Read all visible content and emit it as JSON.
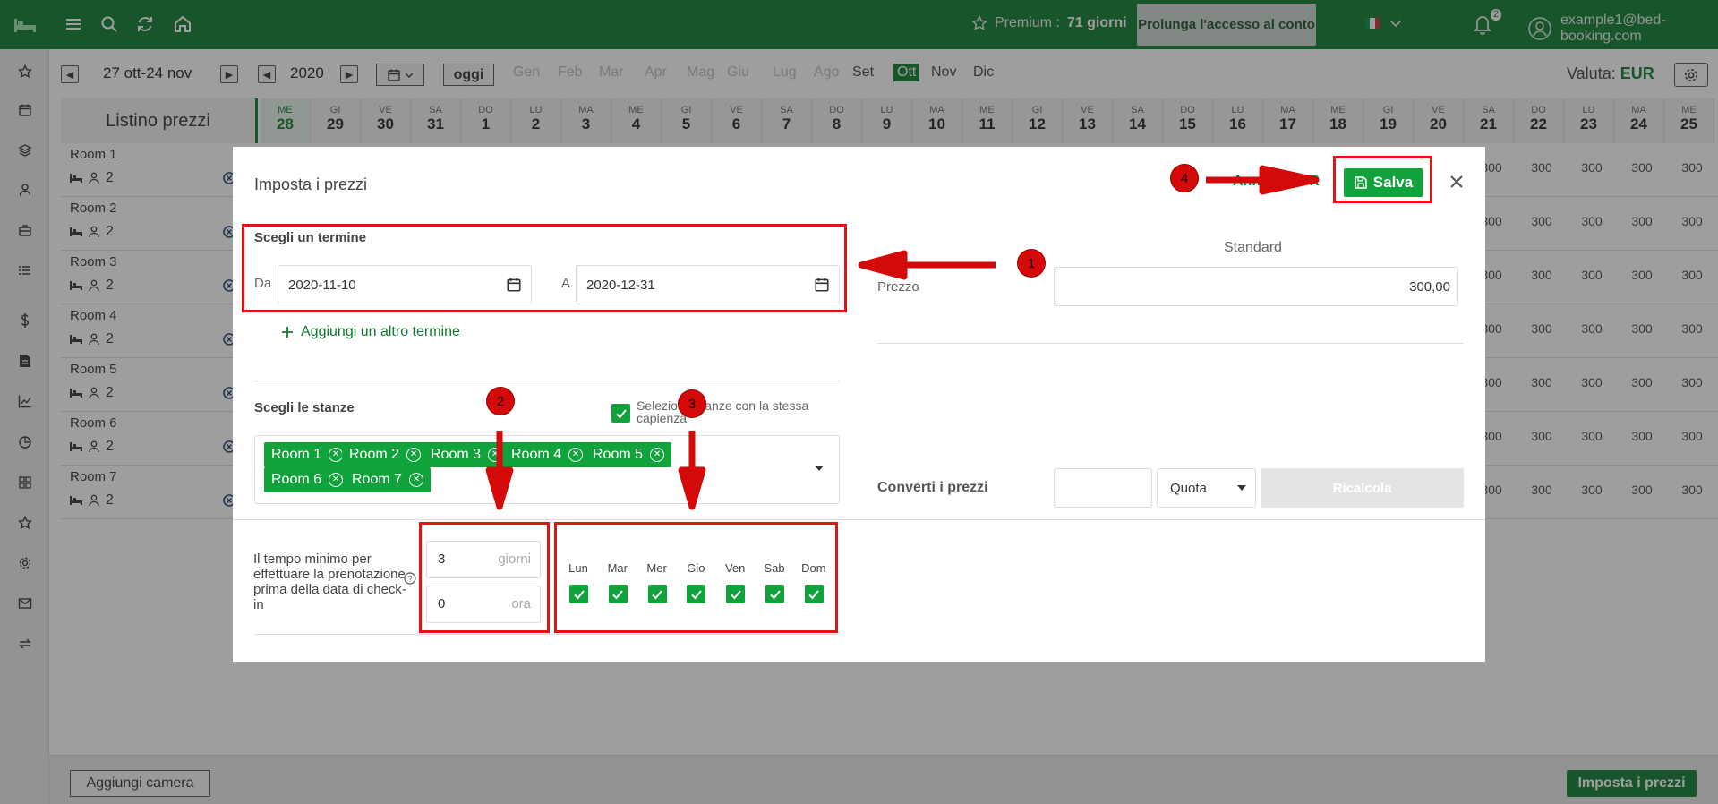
{
  "topbar": {
    "premium_label": "Premium :",
    "premium_days": "71 giorni",
    "extend_button": "Prolunga l'accesso al conto",
    "notifications_count": "2",
    "account_email": "example1@bed-booking.com",
    "brand_color": "#0e7a2f"
  },
  "toolbar": {
    "date_range": "27 ott-24 nov",
    "year": "2020",
    "today_button": "oggi",
    "months": [
      "Gen",
      "Feb",
      "Mar",
      "Apr",
      "Mag",
      "Giu",
      "Lug",
      "Ago",
      "Set",
      "Ott",
      "Nov",
      "Dic"
    ],
    "selected_month": "Ott",
    "currency_label": "Valuta:",
    "currency_value": "EUR"
  },
  "grid": {
    "header_label": "Listino prezzi",
    "days": [
      {
        "n": "ME",
        "d": "28"
      },
      {
        "n": "GI",
        "d": "29"
      },
      {
        "n": "VE",
        "d": "30"
      },
      {
        "n": "SA",
        "d": "31"
      },
      {
        "n": "DO",
        "d": "1"
      },
      {
        "n": "LU",
        "d": "2"
      },
      {
        "n": "MA",
        "d": "3"
      },
      {
        "n": "ME",
        "d": "4"
      },
      {
        "n": "GI",
        "d": "5"
      },
      {
        "n": "VE",
        "d": "6"
      },
      {
        "n": "SA",
        "d": "7"
      },
      {
        "n": "DO",
        "d": "8"
      },
      {
        "n": "LU",
        "d": "9"
      },
      {
        "n": "MA",
        "d": "10"
      },
      {
        "n": "ME",
        "d": "11"
      },
      {
        "n": "GI",
        "d": "12"
      },
      {
        "n": "VE",
        "d": "13"
      },
      {
        "n": "SA",
        "d": "14"
      },
      {
        "n": "DO",
        "d": "15"
      },
      {
        "n": "LU",
        "d": "16"
      },
      {
        "n": "MA",
        "d": "17"
      },
      {
        "n": "ME",
        "d": "18"
      },
      {
        "n": "GI",
        "d": "19"
      },
      {
        "n": "VE",
        "d": "20"
      },
      {
        "n": "SA",
        "d": "21"
      },
      {
        "n": "DO",
        "d": "22"
      },
      {
        "n": "LU",
        "d": "23"
      },
      {
        "n": "MA",
        "d": "24"
      },
      {
        "n": "ME",
        "d": "25"
      }
    ],
    "rooms": [
      {
        "name": "Room 1",
        "capacity": "2"
      },
      {
        "name": "Room 2",
        "capacity": "2"
      },
      {
        "name": "Room 3",
        "capacity": "2"
      },
      {
        "name": "Room 4",
        "capacity": "2"
      },
      {
        "name": "Room 5",
        "capacity": "2"
      },
      {
        "name": "Room 6",
        "capacity": "2"
      },
      {
        "name": "Room 7",
        "capacity": "2"
      }
    ],
    "visible_price": "300"
  },
  "bottom": {
    "add_room_button": "Aggiungi camera",
    "set_prices_button": "Imposta i prezzi"
  },
  "modal": {
    "title": "Imposta i prezzi",
    "cancel_button": "Annulla EUR",
    "save_button": "Salva",
    "term_section_label": "Scegli un termine",
    "from_label": "Da",
    "from_value": "2020-11-10",
    "to_label": "A",
    "to_value": "2020-12-31",
    "add_term_link": "Aggiungi un altro termine",
    "rooms_section_label": "Scegli le stanze",
    "same_capacity_label": "Seleziona stanze con la stessa capienza",
    "room_chips": [
      "Room 1",
      "Room 2",
      "Room 3",
      "Room 4",
      "Room 5",
      "Room 6",
      "Room 7"
    ],
    "lead_time_label": "Il tempo minimo per effettuare la prenotazione prima della data di check-in",
    "lead_days_value": "3",
    "lead_days_unit": "giorni",
    "lead_hours_value": "0",
    "lead_hours_unit": "ora",
    "weekdays": [
      "Lun",
      "Mar",
      "Mer",
      "Gio",
      "Ven",
      "Sab",
      "Dom"
    ],
    "rate_column_label": "Standard",
    "price_label": "Prezzo",
    "price_value": "300,00",
    "convert_label": "Converti i prezzi",
    "convert_mode": "Quota",
    "recalc_button": "Ricalcola"
  },
  "annotations": {
    "markers": [
      "1",
      "2",
      "3",
      "4"
    ],
    "annotation_color": "#e11414"
  }
}
